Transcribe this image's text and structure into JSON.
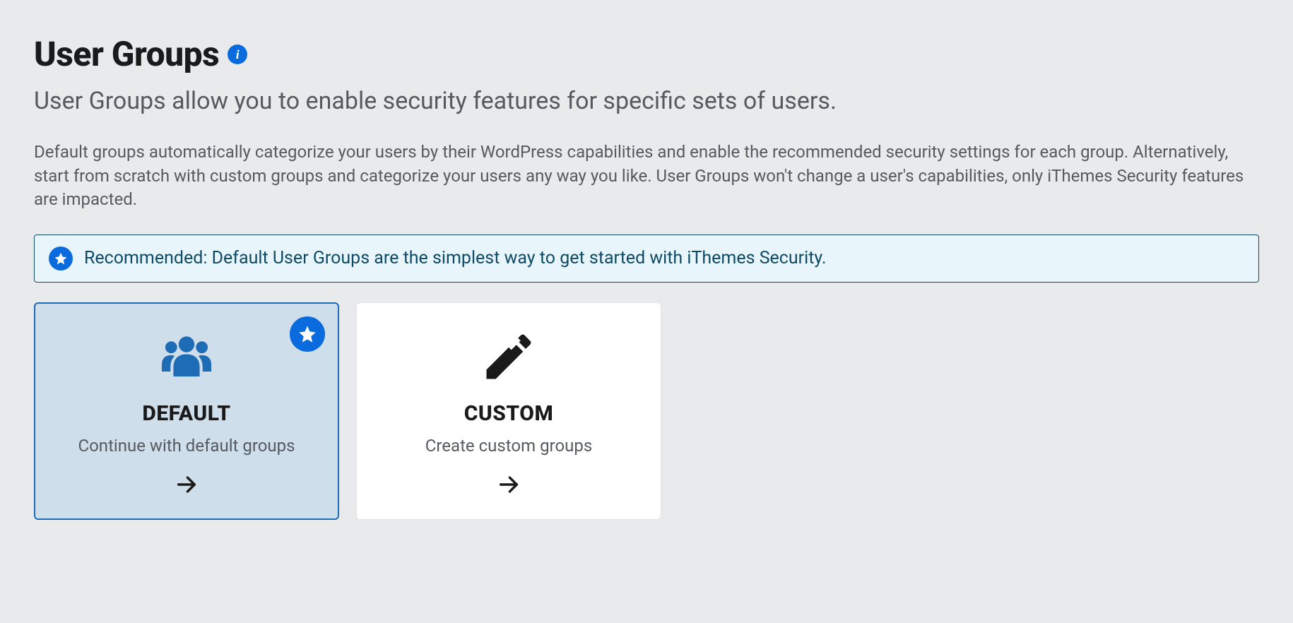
{
  "header": {
    "title": "User Groups",
    "info_glyph": "i"
  },
  "subtitle": "User Groups allow you to enable security features for specific sets of users.",
  "body": "Default groups automatically categorize your users by their WordPress capabilities and enable the recommended security settings for each group. Alternatively, start from scratch with custom groups and categorize your users any way you like. User Groups won't change a user's capabilities, only iThemes Security features are impacted.",
  "recommendation": "Recommended: Default User Groups are the simplest way to get started with iThemes Security.",
  "options": {
    "default": {
      "title": "DEFAULT",
      "desc": "Continue with default groups"
    },
    "custom": {
      "title": "CUSTOM",
      "desc": "Create custom groups"
    }
  }
}
